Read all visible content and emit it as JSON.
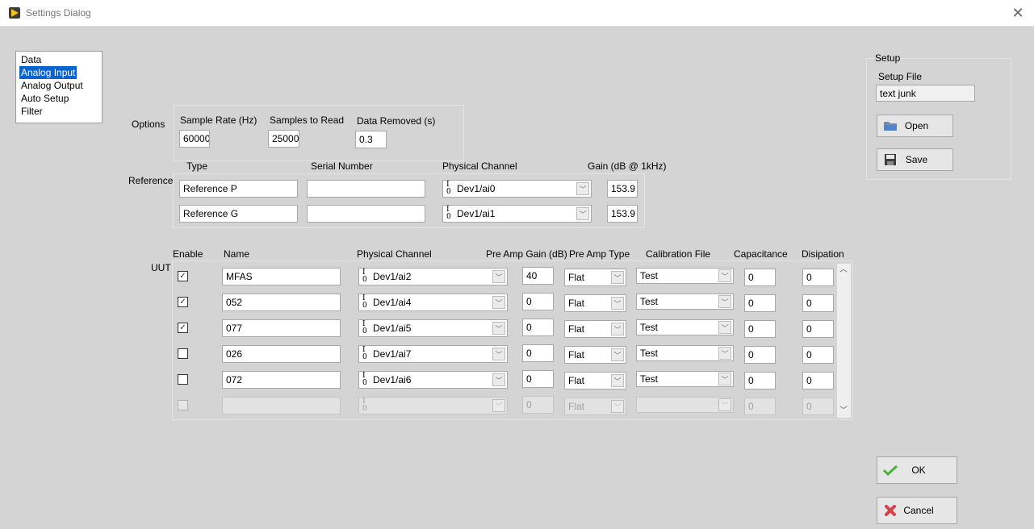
{
  "window": {
    "title": "Settings Dialog",
    "close_icon": "close-icon"
  },
  "nav": {
    "items": [
      {
        "label": "Data",
        "selected": false
      },
      {
        "label": "Analog Input",
        "selected": true
      },
      {
        "label": "Analog Output",
        "selected": false
      },
      {
        "label": "Auto Setup",
        "selected": false
      },
      {
        "label": "Filter",
        "selected": false
      }
    ]
  },
  "options": {
    "label": "Options",
    "sample_rate": {
      "label": "Sample Rate (Hz)",
      "value": "60000"
    },
    "samples_to_read": {
      "label": "Samples to Read",
      "value": "25000"
    },
    "data_removed": {
      "label": "Data Removed (s)",
      "value": "0.3"
    }
  },
  "reference": {
    "label": "Reference",
    "columns": {
      "type": "Type",
      "serial": "Serial Number",
      "channel": "Physical Channel",
      "gain": "Gain (dB @ 1kHz)"
    },
    "rows": [
      {
        "type": "Reference P",
        "serial": "",
        "channel": "Dev1/ai0",
        "gain": "153.9"
      },
      {
        "type": "Reference G",
        "serial": "",
        "channel": "Dev1/ai1",
        "gain": "153.9"
      }
    ]
  },
  "uut": {
    "label": "UUT",
    "io_glyph": {
      "top": "I",
      "bottom": "0"
    },
    "columns": {
      "enable": "Enable",
      "name": "Name",
      "channel": "Physical Channel",
      "preamp_gain": "Pre Amp Gain (dB)",
      "preamp_type": "Pre Amp Type",
      "cal_file": "Calibration File",
      "capacitance": "Capacitance",
      "dissipation": "Disipation"
    },
    "rows": [
      {
        "enabled": true,
        "disabled": false,
        "name": "MFAS",
        "channel": "Dev1/ai2",
        "preamp_gain": "40",
        "preamp_type": "Flat",
        "cal_file": "Test",
        "capacitance": "0",
        "dissipation": "0"
      },
      {
        "enabled": true,
        "disabled": false,
        "name": "052",
        "channel": "Dev1/ai4",
        "preamp_gain": "0",
        "preamp_type": "Flat",
        "cal_file": "Test",
        "capacitance": "0",
        "dissipation": "0"
      },
      {
        "enabled": true,
        "disabled": false,
        "name": "077",
        "channel": "Dev1/ai5",
        "preamp_gain": "0",
        "preamp_type": "Flat",
        "cal_file": "Test",
        "capacitance": "0",
        "dissipation": "0"
      },
      {
        "enabled": false,
        "disabled": false,
        "name": "026",
        "channel": "Dev1/ai7",
        "preamp_gain": "0",
        "preamp_type": "Flat",
        "cal_file": "Test",
        "capacitance": "0",
        "dissipation": "0"
      },
      {
        "enabled": false,
        "disabled": false,
        "name": "072",
        "channel": "Dev1/ai6",
        "preamp_gain": "0",
        "preamp_type": "Flat",
        "cal_file": "Test",
        "capacitance": "0",
        "dissipation": "0"
      },
      {
        "enabled": false,
        "disabled": true,
        "name": "",
        "channel": "",
        "preamp_gain": "0",
        "preamp_type": "Flat",
        "cal_file": "",
        "capacitance": "0",
        "dissipation": "0"
      }
    ]
  },
  "setup": {
    "group_label": "Setup",
    "file_label": "Setup File",
    "file_value": "text junk",
    "open_label": "Open",
    "save_label": "Save"
  },
  "actions": {
    "ok_label": "OK",
    "cancel_label": "Cancel"
  },
  "colors": {
    "selection": "#0a64d0",
    "background": "#d4d4d4",
    "ok_green": "#4caf3c",
    "cancel_red": "#d9404a"
  }
}
